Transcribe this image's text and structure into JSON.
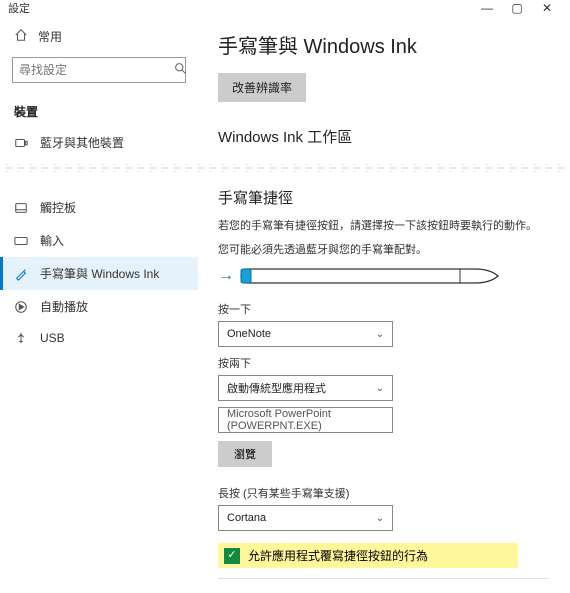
{
  "title": "設定",
  "window_controls": {
    "min": "—",
    "max": "▢",
    "close": "✕"
  },
  "sidebar": {
    "home_label": "常用",
    "search_placeholder": "尋找設定",
    "section_label": "裝置",
    "items": [
      {
        "label": "藍牙與其他裝置",
        "icon": "bluetooth"
      },
      {
        "label": "觸控板",
        "icon": "touchpad"
      },
      {
        "label": "輸入",
        "icon": "keyboard"
      },
      {
        "label": "手寫筆與 Windows Ink",
        "icon": "pen",
        "selected": true
      },
      {
        "label": "自動播放",
        "icon": "autoplay"
      },
      {
        "label": "USB",
        "icon": "usb"
      }
    ]
  },
  "page": {
    "heading": "手寫筆與 Windows Ink",
    "improve_btn": "改善辨識率",
    "workspace_heading": "Windows Ink 工作區",
    "shortcut_heading": "手寫筆捷徑",
    "shortcut_hint1": "若您的手寫筆有捷徑按鈕，請選擇按一下該按鈕時要執行的動作。",
    "shortcut_hint2": "您可能必須先透過藍牙與您的手寫筆配對。",
    "click_once_label": "按一下",
    "click_once_value": "OneNote",
    "click_twice_label": "按兩下",
    "click_twice_value": "啟動傳統型應用程式",
    "click_twice_app": "Microsoft PowerPoint (POWERPNT.EXE)",
    "browse_btn": "瀏覽",
    "long_press_label": "長按 (只有某些手寫筆支援)",
    "long_press_value": "Cortana",
    "allow_override_label": "允許應用程式覆寫捷徑按鈕的行為",
    "allow_override_checked": true
  }
}
